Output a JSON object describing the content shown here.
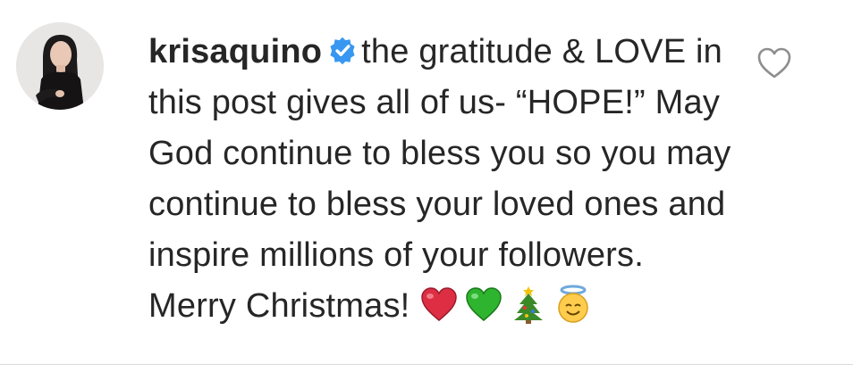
{
  "comment": {
    "username": "krisaquino",
    "text": "the gratitude & LOVE in this post gives all of us- “HOPE!” May God continue to bless you so you may continue to bless your loved ones and inspire millions of your followers. Merry Christmas!",
    "verified": true,
    "emojis": [
      "red-heart",
      "green-heart",
      "christmas-tree",
      "angel-face"
    ]
  },
  "colors": {
    "verified_blue": "#3897f0",
    "text": "#262626",
    "icon_gray": "#8e8e8e"
  }
}
